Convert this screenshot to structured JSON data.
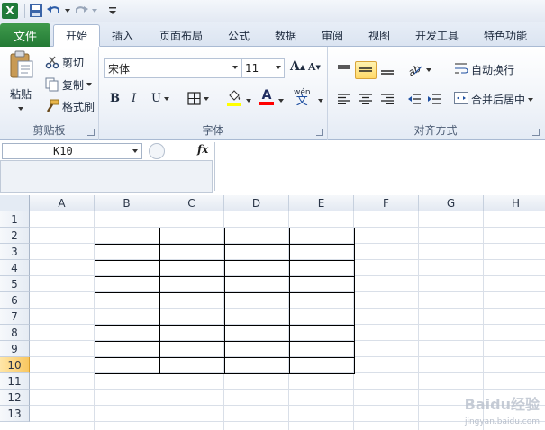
{
  "qat": {
    "app_icon": "X",
    "save_icon": "save-icon",
    "undo_icon": "undo-icon",
    "redo_icon": "redo-icon",
    "customize_icon": "customize-qat-icon"
  },
  "tabs": [
    {
      "label": "文件",
      "type": "file"
    },
    {
      "label": "开始",
      "type": "active"
    },
    {
      "label": "插入"
    },
    {
      "label": "页面布局"
    },
    {
      "label": "公式"
    },
    {
      "label": "数据"
    },
    {
      "label": "审阅"
    },
    {
      "label": "视图"
    },
    {
      "label": "开发工具"
    },
    {
      "label": "特色功能"
    }
  ],
  "ribbon": {
    "clipboard": {
      "label": "剪贴板",
      "paste": "粘贴",
      "cut": "剪切",
      "copy": "复制",
      "format_painter": "格式刷"
    },
    "font": {
      "label": "字体",
      "font_name": "宋体",
      "font_size": "11",
      "grow": "A",
      "shrink": "A",
      "bold": "B",
      "italic": "I",
      "underline": "U",
      "font_color_letter": "A",
      "phonetic": "wén"
    },
    "alignment": {
      "label": "对齐方式",
      "wrap_text": "自动换行",
      "merge_center": "合并后居中"
    }
  },
  "formula_bar": {
    "name_box": "K10",
    "fx": "fx",
    "formula": ""
  },
  "sheet": {
    "columns": [
      "A",
      "B",
      "C",
      "D",
      "E",
      "F",
      "G",
      "H"
    ],
    "rows": [
      "1",
      "2",
      "3",
      "4",
      "5",
      "6",
      "7",
      "8",
      "9",
      "10",
      "11",
      "12",
      "13"
    ],
    "active_row": "10"
  },
  "watermark": {
    "text": "Baidu经验",
    "sub": "jingyan.baidu.com"
  }
}
